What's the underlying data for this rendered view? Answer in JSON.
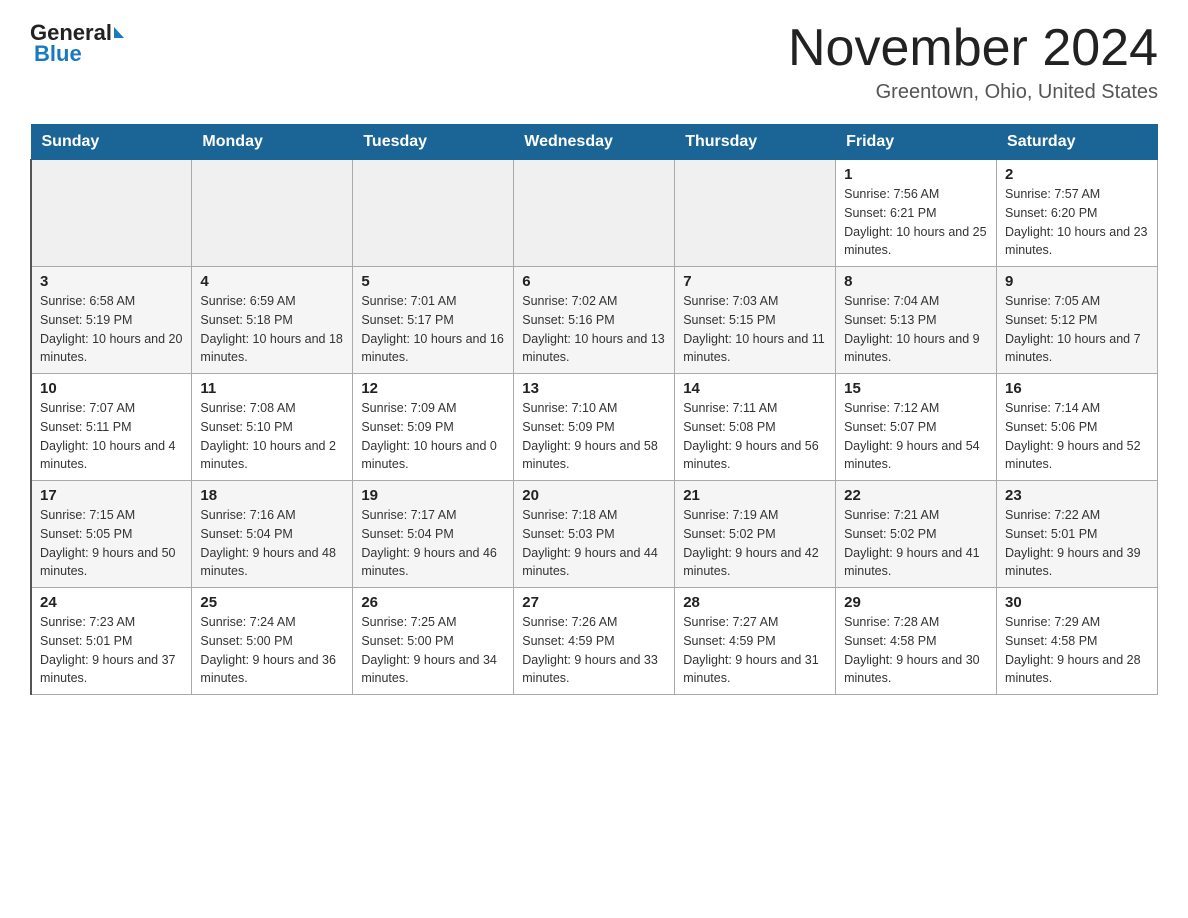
{
  "header": {
    "logo_general": "General",
    "logo_blue": "Blue",
    "month_title": "November 2024",
    "location": "Greentown, Ohio, United States"
  },
  "weekdays": [
    "Sunday",
    "Monday",
    "Tuesday",
    "Wednesday",
    "Thursday",
    "Friday",
    "Saturday"
  ],
  "weeks": [
    [
      {
        "day": "",
        "info": ""
      },
      {
        "day": "",
        "info": ""
      },
      {
        "day": "",
        "info": ""
      },
      {
        "day": "",
        "info": ""
      },
      {
        "day": "",
        "info": ""
      },
      {
        "day": "1",
        "info": "Sunrise: 7:56 AM\nSunset: 6:21 PM\nDaylight: 10 hours and 25 minutes."
      },
      {
        "day": "2",
        "info": "Sunrise: 7:57 AM\nSunset: 6:20 PM\nDaylight: 10 hours and 23 minutes."
      }
    ],
    [
      {
        "day": "3",
        "info": "Sunrise: 6:58 AM\nSunset: 5:19 PM\nDaylight: 10 hours and 20 minutes."
      },
      {
        "day": "4",
        "info": "Sunrise: 6:59 AM\nSunset: 5:18 PM\nDaylight: 10 hours and 18 minutes."
      },
      {
        "day": "5",
        "info": "Sunrise: 7:01 AM\nSunset: 5:17 PM\nDaylight: 10 hours and 16 minutes."
      },
      {
        "day": "6",
        "info": "Sunrise: 7:02 AM\nSunset: 5:16 PM\nDaylight: 10 hours and 13 minutes."
      },
      {
        "day": "7",
        "info": "Sunrise: 7:03 AM\nSunset: 5:15 PM\nDaylight: 10 hours and 11 minutes."
      },
      {
        "day": "8",
        "info": "Sunrise: 7:04 AM\nSunset: 5:13 PM\nDaylight: 10 hours and 9 minutes."
      },
      {
        "day": "9",
        "info": "Sunrise: 7:05 AM\nSunset: 5:12 PM\nDaylight: 10 hours and 7 minutes."
      }
    ],
    [
      {
        "day": "10",
        "info": "Sunrise: 7:07 AM\nSunset: 5:11 PM\nDaylight: 10 hours and 4 minutes."
      },
      {
        "day": "11",
        "info": "Sunrise: 7:08 AM\nSunset: 5:10 PM\nDaylight: 10 hours and 2 minutes."
      },
      {
        "day": "12",
        "info": "Sunrise: 7:09 AM\nSunset: 5:09 PM\nDaylight: 10 hours and 0 minutes."
      },
      {
        "day": "13",
        "info": "Sunrise: 7:10 AM\nSunset: 5:09 PM\nDaylight: 9 hours and 58 minutes."
      },
      {
        "day": "14",
        "info": "Sunrise: 7:11 AM\nSunset: 5:08 PM\nDaylight: 9 hours and 56 minutes."
      },
      {
        "day": "15",
        "info": "Sunrise: 7:12 AM\nSunset: 5:07 PM\nDaylight: 9 hours and 54 minutes."
      },
      {
        "day": "16",
        "info": "Sunrise: 7:14 AM\nSunset: 5:06 PM\nDaylight: 9 hours and 52 minutes."
      }
    ],
    [
      {
        "day": "17",
        "info": "Sunrise: 7:15 AM\nSunset: 5:05 PM\nDaylight: 9 hours and 50 minutes."
      },
      {
        "day": "18",
        "info": "Sunrise: 7:16 AM\nSunset: 5:04 PM\nDaylight: 9 hours and 48 minutes."
      },
      {
        "day": "19",
        "info": "Sunrise: 7:17 AM\nSunset: 5:04 PM\nDaylight: 9 hours and 46 minutes."
      },
      {
        "day": "20",
        "info": "Sunrise: 7:18 AM\nSunset: 5:03 PM\nDaylight: 9 hours and 44 minutes."
      },
      {
        "day": "21",
        "info": "Sunrise: 7:19 AM\nSunset: 5:02 PM\nDaylight: 9 hours and 42 minutes."
      },
      {
        "day": "22",
        "info": "Sunrise: 7:21 AM\nSunset: 5:02 PM\nDaylight: 9 hours and 41 minutes."
      },
      {
        "day": "23",
        "info": "Sunrise: 7:22 AM\nSunset: 5:01 PM\nDaylight: 9 hours and 39 minutes."
      }
    ],
    [
      {
        "day": "24",
        "info": "Sunrise: 7:23 AM\nSunset: 5:01 PM\nDaylight: 9 hours and 37 minutes."
      },
      {
        "day": "25",
        "info": "Sunrise: 7:24 AM\nSunset: 5:00 PM\nDaylight: 9 hours and 36 minutes."
      },
      {
        "day": "26",
        "info": "Sunrise: 7:25 AM\nSunset: 5:00 PM\nDaylight: 9 hours and 34 minutes."
      },
      {
        "day": "27",
        "info": "Sunrise: 7:26 AM\nSunset: 4:59 PM\nDaylight: 9 hours and 33 minutes."
      },
      {
        "day": "28",
        "info": "Sunrise: 7:27 AM\nSunset: 4:59 PM\nDaylight: 9 hours and 31 minutes."
      },
      {
        "day": "29",
        "info": "Sunrise: 7:28 AM\nSunset: 4:58 PM\nDaylight: 9 hours and 30 minutes."
      },
      {
        "day": "30",
        "info": "Sunrise: 7:29 AM\nSunset: 4:58 PM\nDaylight: 9 hours and 28 minutes."
      }
    ]
  ]
}
